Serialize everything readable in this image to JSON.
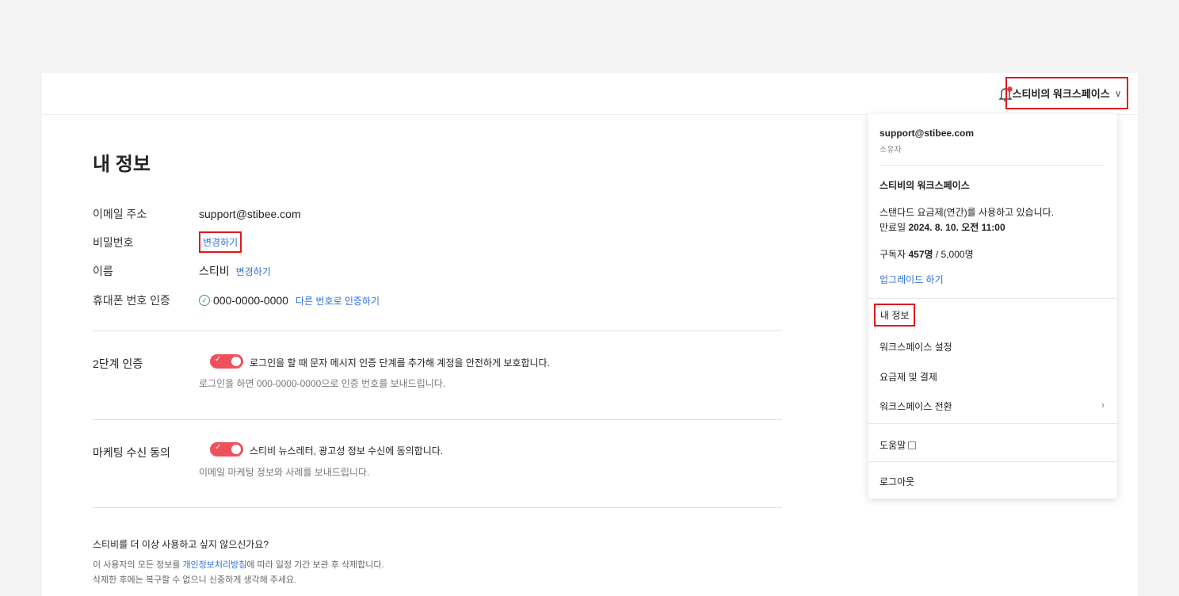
{
  "header": {
    "workspace_button": "스티비의 워크스페이스",
    "workspace_chevron": "∨"
  },
  "page": {
    "title": "내 정보"
  },
  "profile": {
    "email_label": "이메일 주소",
    "email_value": "support@stibee.com",
    "password_label": "비밀번호",
    "password_change": "변경하기",
    "name_label": "이름",
    "name_value": "스티비",
    "name_change": "변경하기",
    "phone_label": "휴대폰 번호 인증",
    "phone_value": "000-0000-0000",
    "phone_change": "다른 번호로 인증하기"
  },
  "two_factor": {
    "label": "2단계 인증",
    "enabled": true,
    "text": "로그인을 할 때 문자 메시지 인증 단계를 추가해 계정을 안전하게 보호합니다.",
    "sub": "로그인을 하면 000-0000-0000으로 인증 번호를 보내드립니다."
  },
  "marketing": {
    "label": "마케팅 수신 동의",
    "enabled": true,
    "text": "스티비 뉴스레터, 광고성 정보 수신에 동의합니다.",
    "sub": "이메일 마케팅 정보와 사례를 보내드립니다."
  },
  "leave": {
    "question": "스티비를 더 이상 사용하고 싶지 않으신가요?",
    "line1_prefix": "이 사용자의 모든 정보를 ",
    "line1_link": "개인정보처리방침",
    "line1_suffix": "에 따라 일정 기간 보관 후 삭제합니다.",
    "line2": "삭제한 후에는 복구할 수 없으니 신중하게 생각해 주세요."
  },
  "menu": {
    "email": "support@stibee.com",
    "role": "소유자",
    "workspace_name": "스티비의 워크스페이스",
    "plan": "스탠다드 요금제(연간)를 사용하고 있습니다.",
    "expire_label": "만료일 ",
    "expire_value": "2024. 8. 10. 오전 11:00",
    "subs_label": "구독자 ",
    "subs_count": "457명",
    "subs_limit": " / 5,000명",
    "upgrade": "업그레이드 하기",
    "my_info": "내 정보",
    "ws_settings": "워크스페이스 설정",
    "billing": "요금제 및 결제",
    "ws_switch": "워크스페이스 전환",
    "ws_switch_arrow": "›",
    "help": "도움말",
    "logout": "로그아웃"
  },
  "colors": {
    "accent_link": "#2f6fe0",
    "toggle_on": "#f0505a",
    "highlight_box": "#e01818",
    "notification_dot": "#e03a3a"
  }
}
